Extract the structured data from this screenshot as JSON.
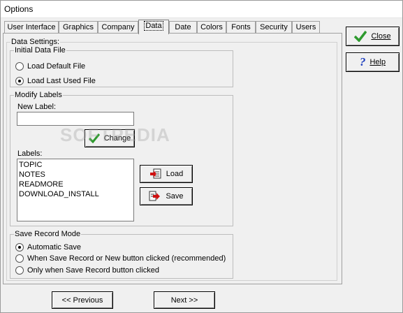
{
  "window": {
    "title": "Options"
  },
  "tabs": [
    {
      "label": "User Interface"
    },
    {
      "label": "Graphics"
    },
    {
      "label": "Company"
    },
    {
      "label": "Data"
    },
    {
      "label": "Date"
    },
    {
      "label": "Colors"
    },
    {
      "label": "Fonts"
    },
    {
      "label": "Security"
    },
    {
      "label": "Users"
    }
  ],
  "data_settings": {
    "title": "Data Settings:",
    "initial_file": {
      "title": "Initial Data File",
      "options": [
        {
          "label": "Load Default File",
          "selected": false
        },
        {
          "label": "Load Last Used File",
          "selected": true
        }
      ]
    },
    "modify_labels": {
      "title": "Modify Labels",
      "new_label_caption": "New Label:",
      "new_label_value": "",
      "change_button": "Change",
      "labels_caption": "Labels:",
      "labels": [
        "TOPIC",
        "NOTES",
        "READMORE",
        "DOWNLOAD_INSTALL"
      ],
      "load_button": "Load",
      "save_button": "Save"
    },
    "save_mode": {
      "title": "Save Record Mode",
      "options": [
        {
          "label": "Automatic Save",
          "selected": true
        },
        {
          "label": "When Save Record or New button clicked (recommended)",
          "selected": false
        },
        {
          "label": "Only when Save Record button clicked",
          "selected": false
        }
      ]
    }
  },
  "side_buttons": {
    "close": "Close",
    "help": "Help"
  },
  "nav": {
    "previous": "<< Previous",
    "next": "Next >>"
  },
  "watermark": "SOFTPEDIA",
  "colors": {
    "check_green": "#2e9a2e",
    "help_blue": "#1f3fbf",
    "arrow_red": "#d01010"
  }
}
